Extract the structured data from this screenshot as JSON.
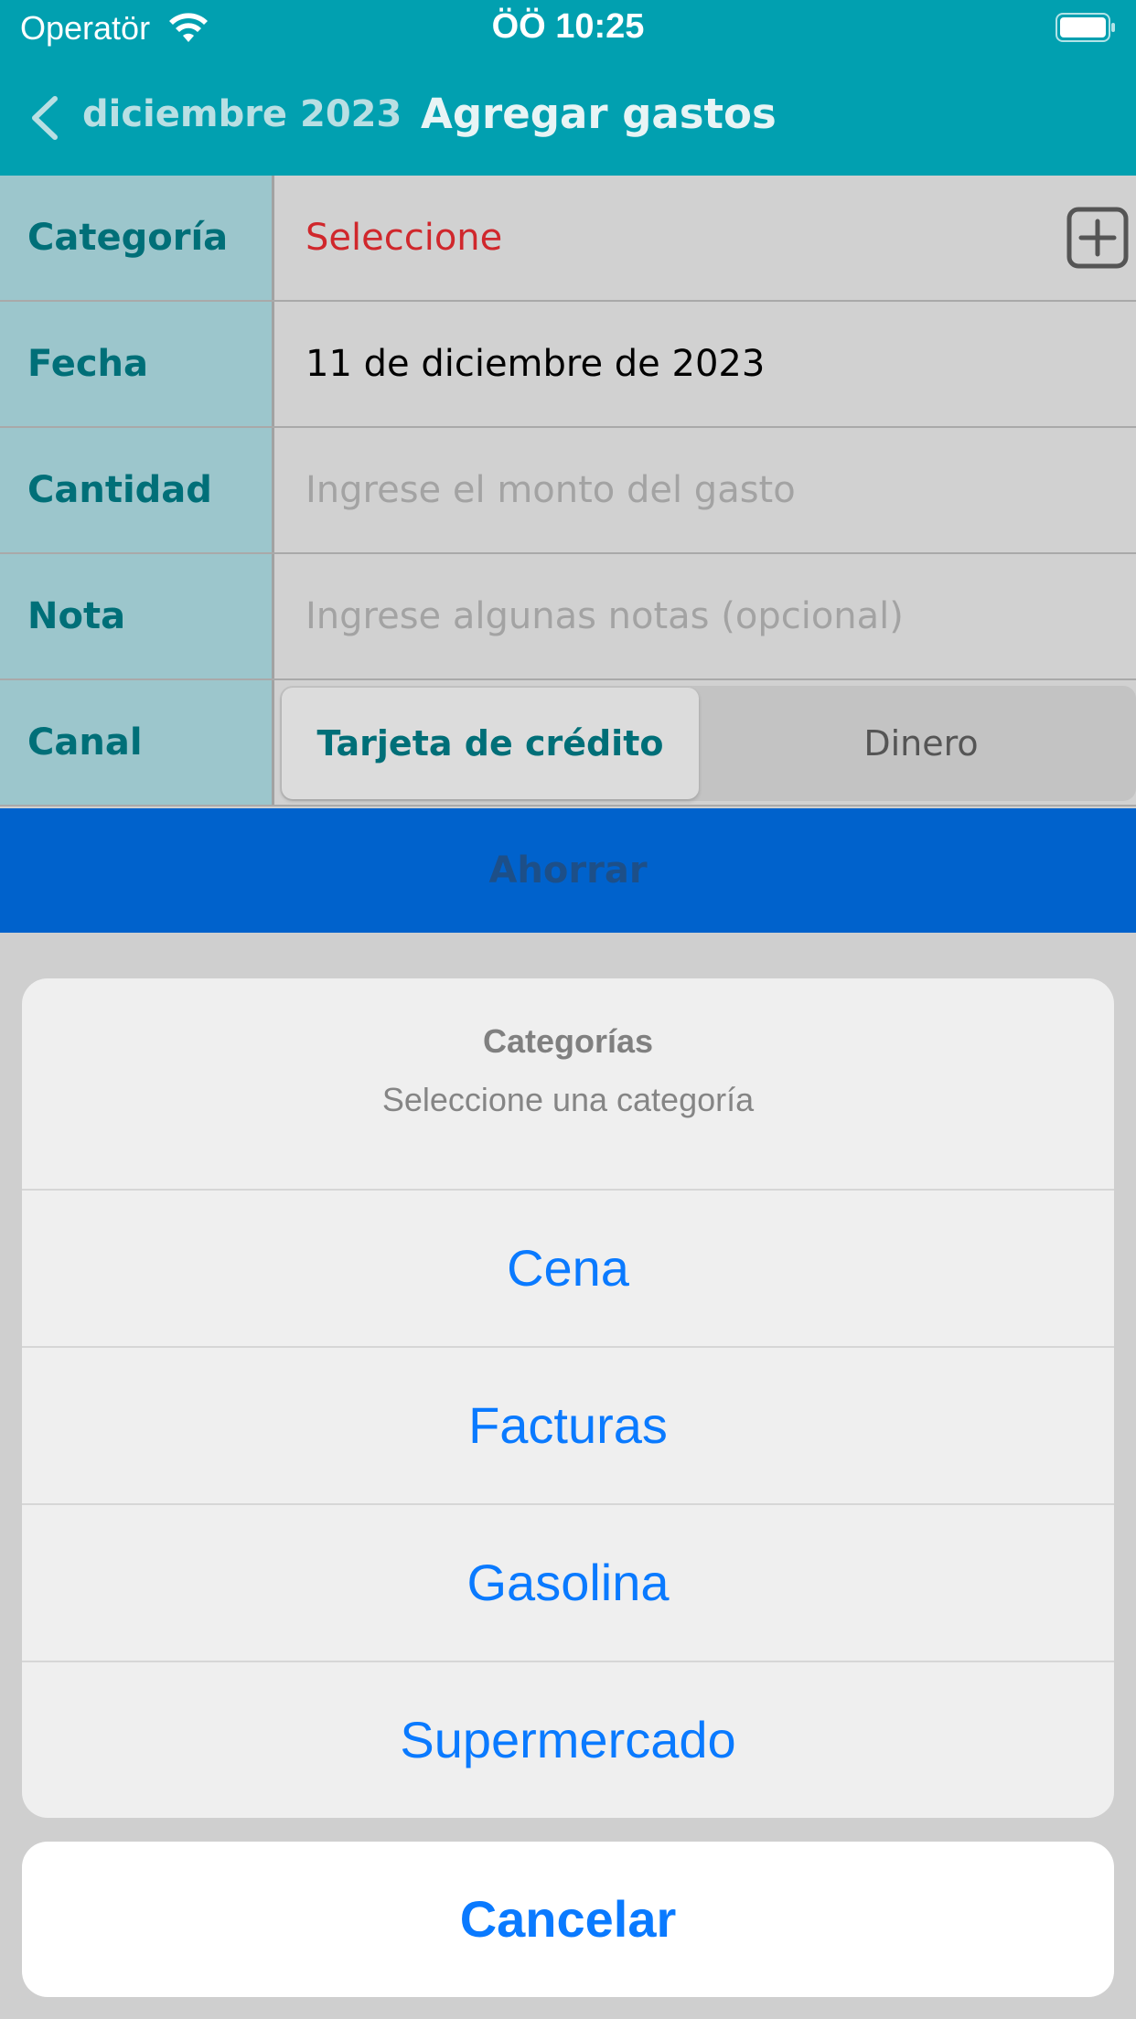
{
  "status_bar": {
    "carrier": "Operatör",
    "time": "ÖÖ 10:25",
    "icons": [
      "wifi-icon",
      "battery-icon"
    ]
  },
  "nav": {
    "back_label": "diciembre 2023",
    "title": "Agregar gastos"
  },
  "form": {
    "category": {
      "label": "Categoría",
      "value": "Seleccione"
    },
    "date": {
      "label": "Fecha",
      "value": "11 de diciembre de 2023"
    },
    "amount": {
      "label": "Cantidad",
      "placeholder": "Ingrese el monto del gasto"
    },
    "note": {
      "label": "Nota",
      "placeholder": "Ingrese algunas notas (opcional)"
    },
    "channel": {
      "label": "Canal",
      "options": [
        "Tarjeta de crédito",
        "Dinero"
      ],
      "selected": "Tarjeta de crédito"
    }
  },
  "save_button": "Ahorrar",
  "action_sheet": {
    "title": "Categorías",
    "message": "Seleccione una categoría",
    "options": [
      "Cena",
      "Facturas",
      "Gasolina",
      "Supermercado"
    ],
    "cancel": "Cancelar"
  },
  "colors": {
    "nav_bg": "#01a0b0",
    "label_text": "#006f78",
    "select_red": "#d0272c",
    "save_bg": "#0062cc",
    "ios_blue": "#0a7aff"
  }
}
